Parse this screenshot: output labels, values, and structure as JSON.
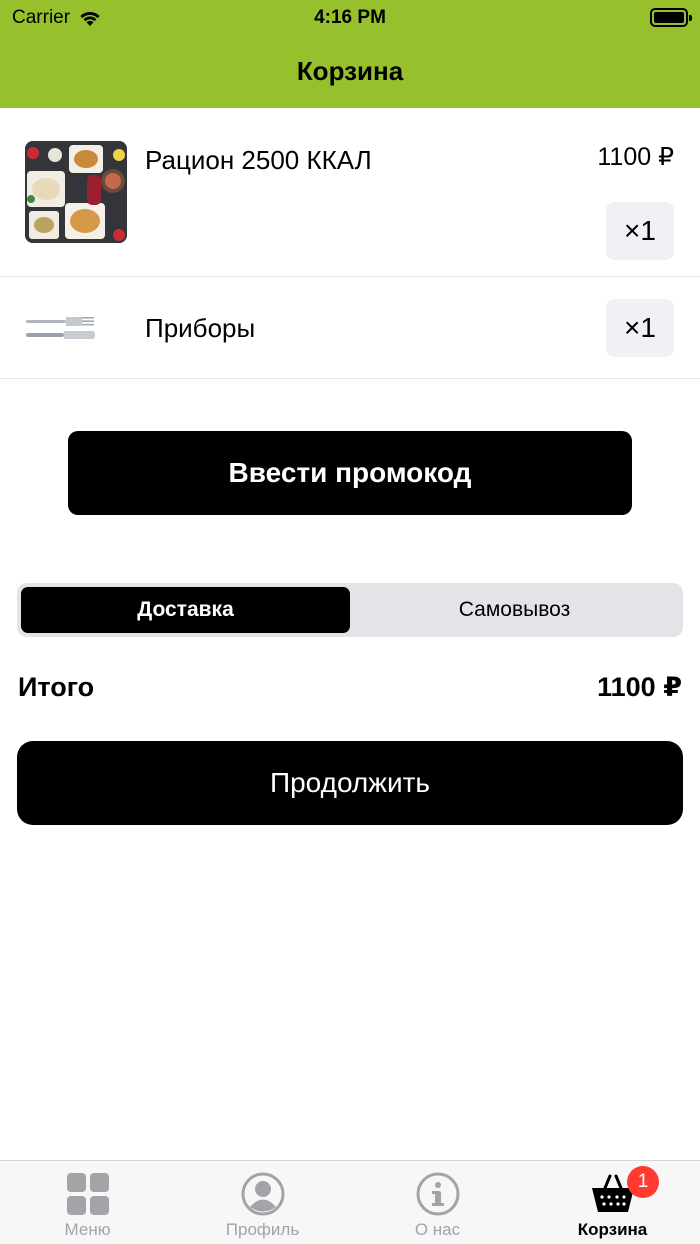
{
  "status_bar": {
    "carrier": "Carrier",
    "time": "4:16 PM"
  },
  "nav": {
    "title": "Корзина"
  },
  "cart": {
    "items": [
      {
        "name": "Рацион 2500 ККАЛ",
        "price": "1100 ₽",
        "quantity": "×1"
      },
      {
        "name": "Приборы",
        "quantity": "×1"
      }
    ]
  },
  "promo": {
    "label": "Ввести промокод"
  },
  "delivery_options": {
    "selected": "Доставка",
    "other": "Самовывоз"
  },
  "total": {
    "label": "Итого",
    "value": "1100 ₽"
  },
  "continue": {
    "label": "Продолжить"
  },
  "tab_bar": {
    "tabs": [
      {
        "label": "Меню",
        "icon": "menu-grid-icon"
      },
      {
        "label": "Профиль",
        "icon": "profile-icon"
      },
      {
        "label": "О нас",
        "icon": "info-icon"
      },
      {
        "label": "Корзина",
        "icon": "basket-icon",
        "badge": "1"
      }
    ],
    "active_tab": "Корзина"
  },
  "colors": {
    "header": "#96c12c",
    "badge": "#ff3b30"
  }
}
